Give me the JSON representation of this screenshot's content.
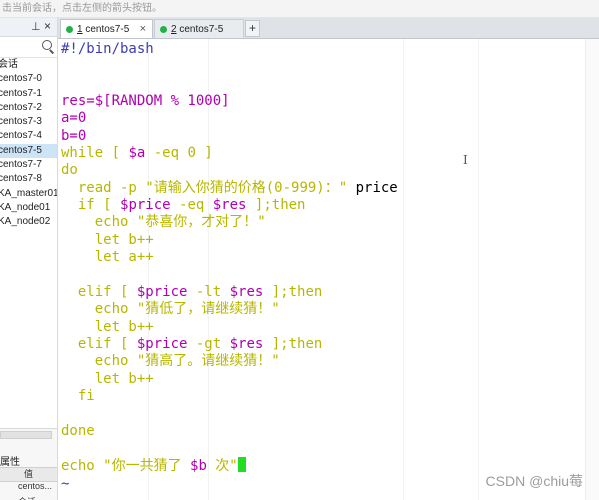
{
  "hint_bar": {
    "text": "击当前会话，点击左侧的箭头按钮。"
  },
  "sidebar": {
    "group_label": "会话",
    "items": [
      {
        "label": "centos7-0"
      },
      {
        "label": "centos7-1"
      },
      {
        "label": "centos7-2"
      },
      {
        "label": "centos7-3"
      },
      {
        "label": "centos7-4"
      },
      {
        "label": "centos7-5",
        "selected": true
      },
      {
        "label": "centos7-7"
      },
      {
        "label": "centos7-8"
      },
      {
        "label": "KA_master01"
      },
      {
        "label": "KA_node01"
      },
      {
        "label": "KA_node02"
      }
    ],
    "properties_title": "属性",
    "properties_header": "值",
    "properties_rows": [
      "centos...",
      "会话"
    ]
  },
  "tabs": [
    {
      "number": "1",
      "label": "centos7-5",
      "active": true
    },
    {
      "number": "2",
      "label": "centos7-5",
      "active": false
    }
  ],
  "terminal": {
    "shebang": "#!/bin/bash",
    "line_res": "res=$[RANDOM % 1000]",
    "line_a": "a=0",
    "line_b": "b=0",
    "while_kw": "while",
    "while_mid": " [ ",
    "var_a": "$a",
    "while_rest": " -eq 0 ]",
    "do_kw": "do",
    "read_cmd": "  read -p ",
    "read_prompt": "\"请输入你猜的价格(0-999)：\"",
    "read_var": " price",
    "if_kw": "  if",
    "if_open": " [ ",
    "var_price_1": "$price",
    "if_op": " -eq ",
    "var_res_1": "$res",
    "if_close": " ];",
    "then_1": "then",
    "echo_1": "    echo ",
    "msg_1": "\"恭喜你，才对了！\"",
    "let_b_1": "    let b++",
    "let_a": "    let a++",
    "elif1_kw": "  elif",
    "elif1_open": " [ ",
    "var_price_2": "$price",
    "elif1_op": " -lt ",
    "var_res_2": "$res",
    "elif1_close": " ];",
    "then_2": "then",
    "echo_2": "    echo ",
    "msg_2": "\"猜低了，请继续猜！\"",
    "let_b_2": "    let b++",
    "elif2_kw": "  elif",
    "elif2_open": " [ ",
    "var_price_3": "$price",
    "elif2_op": " -gt ",
    "var_res_3": "$res",
    "elif2_close": " ];",
    "then_3": "then",
    "echo_3": "    echo ",
    "msg_3": "\"猜高了。请继续猜！\"",
    "let_b_3": "    let b++",
    "fi_kw": "  fi",
    "done_kw": "done",
    "final_echo": "echo ",
    "final_msg_1": "\"你一共猜了 ",
    "final_var": "$b",
    "final_msg_2": " 次\"",
    "tilde": "~"
  },
  "watermark": "CSDN @chiu莓"
}
